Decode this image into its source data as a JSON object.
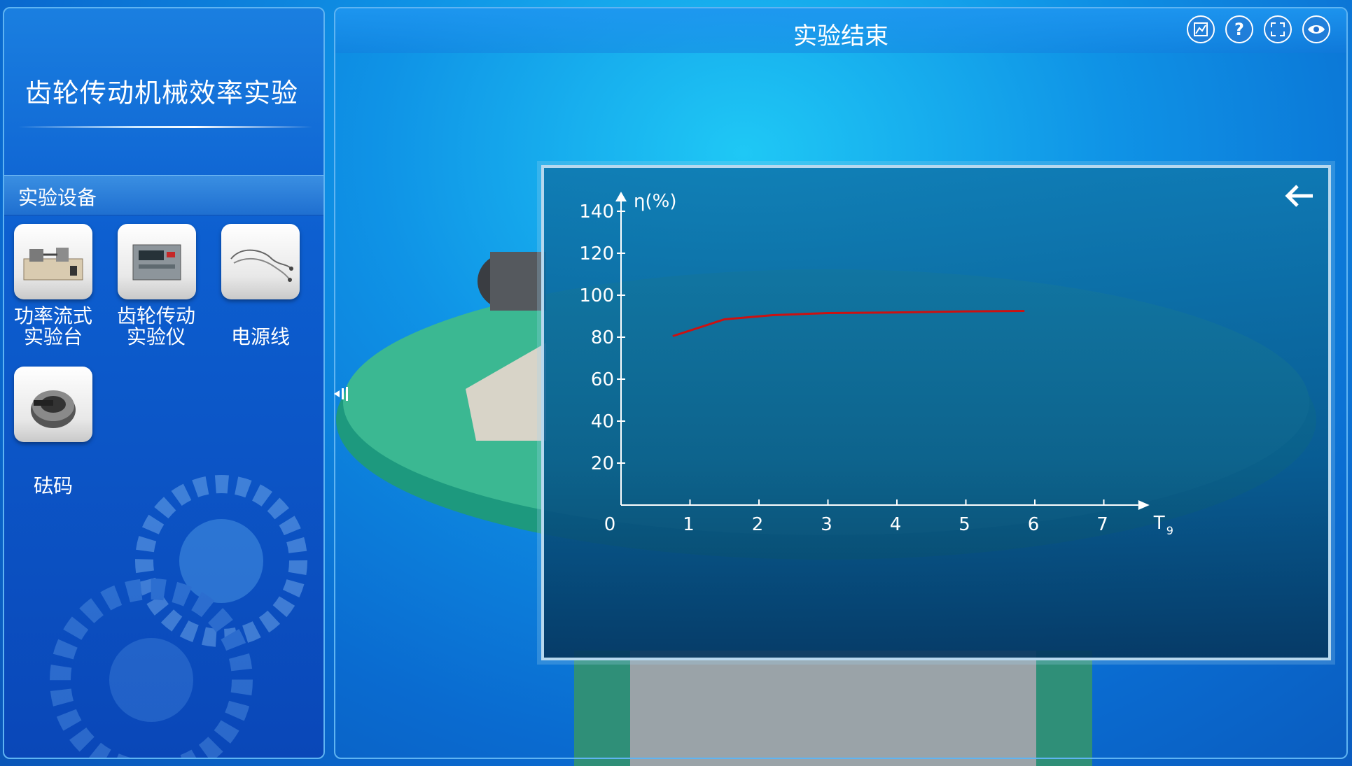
{
  "app": {
    "title": "齿轮传动机械效率实验"
  },
  "sidebar": {
    "section_title": "实验设备",
    "items": [
      {
        "label": "功率流式\n实验台",
        "line1": "功率流式",
        "line2": "实验台",
        "icon": "test-bench-icon"
      },
      {
        "label": "齿轮传动\n实验仪",
        "line1": "齿轮传动",
        "line2": "实验仪",
        "icon": "instrument-icon"
      },
      {
        "label": "电源线",
        "line1": "电源线",
        "line2": "",
        "icon": "power-cable-icon"
      },
      {
        "label": "砝码",
        "line1": "砝码",
        "line2": "",
        "icon": "weight-icon"
      }
    ]
  },
  "header": {
    "status": "实验结束",
    "buttons": [
      {
        "name": "report-button",
        "icon": "chart-icon"
      },
      {
        "name": "help-button",
        "icon": "question-icon",
        "glyph": "?"
      },
      {
        "name": "fullscreen-button",
        "icon": "expand-icon"
      },
      {
        "name": "view-button",
        "icon": "eye-icon"
      }
    ]
  },
  "chart_data": {
    "type": "line",
    "ylabel": "η(%)",
    "xlabel": "T9",
    "xlabel_main": "T",
    "xlabel_sub": "9",
    "xlim": [
      0,
      7.5
    ],
    "ylim": [
      0,
      140
    ],
    "x_ticks": [
      0,
      1,
      2,
      3,
      4,
      5,
      6,
      7
    ],
    "y_ticks": [
      20,
      40,
      60,
      80,
      100,
      120,
      140
    ],
    "grid": false,
    "series": [
      {
        "color": "#cc1111",
        "x": [
          0.75,
          1.5,
          2.2,
          3.0,
          4.0,
          5.0,
          5.85
        ],
        "y": [
          80.5,
          88.5,
          90.5,
          91.5,
          91.8,
          92.3,
          92.5
        ]
      }
    ]
  },
  "colors": {
    "accent": "#5fb4f2",
    "line": "#cc1111",
    "panel_border": "#b7d8ee"
  }
}
